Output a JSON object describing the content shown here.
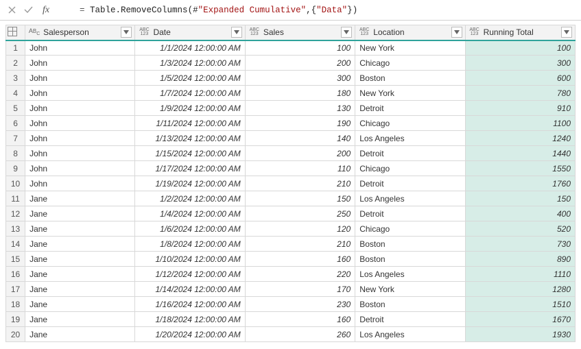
{
  "formula_bar": {
    "eq": "= ",
    "fn": "Table.RemoveColumns",
    "open": "(",
    "arg1a": "#",
    "arg1b": "\"Expanded Cumulative\"",
    "comma": ",",
    "brace_open": "{",
    "arg2": "\"Data\"",
    "brace_close": "}",
    "close": ")"
  },
  "columns": {
    "salesperson": "Salesperson",
    "date": "Date",
    "sales": "Sales",
    "location": "Location",
    "running_total": "Running Total"
  },
  "type_labels": {
    "abc": "ABC",
    "any_top": "ABC",
    "any_bot": "123"
  },
  "rows": [
    {
      "n": "1",
      "sp": "John",
      "dt": "1/1/2024 12:00:00 AM",
      "sl": "100",
      "loc": "New York",
      "rt": "100"
    },
    {
      "n": "2",
      "sp": "John",
      "dt": "1/3/2024 12:00:00 AM",
      "sl": "200",
      "loc": "Chicago",
      "rt": "300"
    },
    {
      "n": "3",
      "sp": "John",
      "dt": "1/5/2024 12:00:00 AM",
      "sl": "300",
      "loc": "Boston",
      "rt": "600"
    },
    {
      "n": "4",
      "sp": "John",
      "dt": "1/7/2024 12:00:00 AM",
      "sl": "180",
      "loc": "New York",
      "rt": "780"
    },
    {
      "n": "5",
      "sp": "John",
      "dt": "1/9/2024 12:00:00 AM",
      "sl": "130",
      "loc": "Detroit",
      "rt": "910"
    },
    {
      "n": "6",
      "sp": "John",
      "dt": "1/11/2024 12:00:00 AM",
      "sl": "190",
      "loc": "Chicago",
      "rt": "1100"
    },
    {
      "n": "7",
      "sp": "John",
      "dt": "1/13/2024 12:00:00 AM",
      "sl": "140",
      "loc": "Los Angeles",
      "rt": "1240"
    },
    {
      "n": "8",
      "sp": "John",
      "dt": "1/15/2024 12:00:00 AM",
      "sl": "200",
      "loc": "Detroit",
      "rt": "1440"
    },
    {
      "n": "9",
      "sp": "John",
      "dt": "1/17/2024 12:00:00 AM",
      "sl": "110",
      "loc": "Chicago",
      "rt": "1550"
    },
    {
      "n": "10",
      "sp": "John",
      "dt": "1/19/2024 12:00:00 AM",
      "sl": "210",
      "loc": "Detroit",
      "rt": "1760"
    },
    {
      "n": "11",
      "sp": "Jane",
      "dt": "1/2/2024 12:00:00 AM",
      "sl": "150",
      "loc": "Los Angeles",
      "rt": "150"
    },
    {
      "n": "12",
      "sp": "Jane",
      "dt": "1/4/2024 12:00:00 AM",
      "sl": "250",
      "loc": "Detroit",
      "rt": "400"
    },
    {
      "n": "13",
      "sp": "Jane",
      "dt": "1/6/2024 12:00:00 AM",
      "sl": "120",
      "loc": "Chicago",
      "rt": "520"
    },
    {
      "n": "14",
      "sp": "Jane",
      "dt": "1/8/2024 12:00:00 AM",
      "sl": "210",
      "loc": "Boston",
      "rt": "730"
    },
    {
      "n": "15",
      "sp": "Jane",
      "dt": "1/10/2024 12:00:00 AM",
      "sl": "160",
      "loc": "Boston",
      "rt": "890"
    },
    {
      "n": "16",
      "sp": "Jane",
      "dt": "1/12/2024 12:00:00 AM",
      "sl": "220",
      "loc": "Los Angeles",
      "rt": "1110"
    },
    {
      "n": "17",
      "sp": "Jane",
      "dt": "1/14/2024 12:00:00 AM",
      "sl": "170",
      "loc": "New York",
      "rt": "1280"
    },
    {
      "n": "18",
      "sp": "Jane",
      "dt": "1/16/2024 12:00:00 AM",
      "sl": "230",
      "loc": "Boston",
      "rt": "1510"
    },
    {
      "n": "19",
      "sp": "Jane",
      "dt": "1/18/2024 12:00:00 AM",
      "sl": "160",
      "loc": "Detroit",
      "rt": "1670"
    },
    {
      "n": "20",
      "sp": "Jane",
      "dt": "1/20/2024 12:00:00 AM",
      "sl": "260",
      "loc": "Los Angeles",
      "rt": "1930"
    }
  ]
}
